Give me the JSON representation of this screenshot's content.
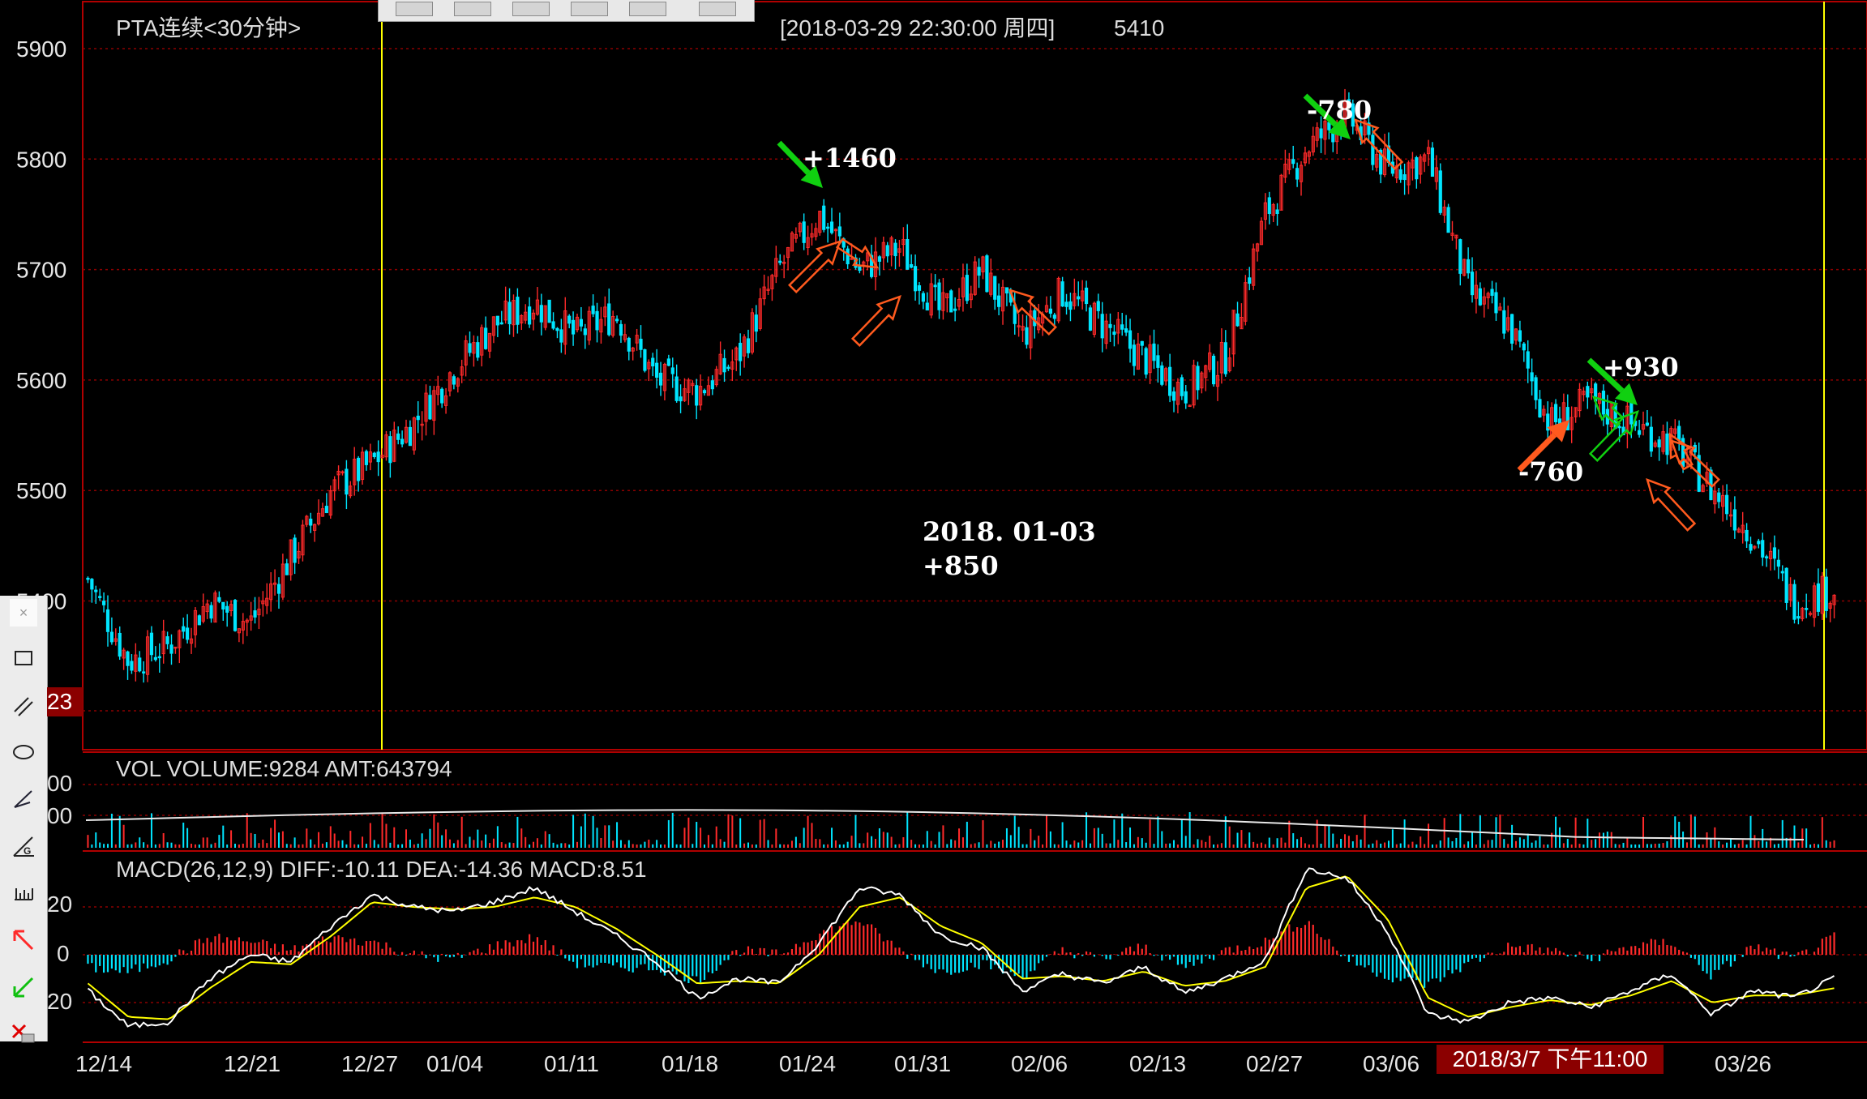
{
  "header": {
    "symbol_title": "PTA连续<30分钟>",
    "datetime_info": "[2018-03-29  22:30:00 周四]",
    "last_price": "5410"
  },
  "volume_panel": {
    "label": "VOL  VOLUME:9284 AMT:643794",
    "y_tick_labels": [
      "00",
      "00"
    ]
  },
  "macd_panel": {
    "label": "MACD(26,12,9)  DIFF:-10.11 DEA:-14.36 MACD:8.51",
    "y_tick_labels": [
      "20",
      "0",
      "20"
    ]
  },
  "cursor": {
    "date_label": "2018/3/7 下午11:00",
    "price_tag": "23"
  },
  "annotations": [
    {
      "text": "+1460",
      "color": "#ffffff"
    },
    {
      "text": "-780",
      "color": "#ffffff"
    },
    {
      "text": "+930",
      "color": "#ffffff"
    },
    {
      "text": "-760",
      "color": "#ffffff"
    },
    {
      "text": "2018. 01-03",
      "color": "#ffffff"
    },
    {
      "text": "+850",
      "color": "#ffffff"
    }
  ],
  "toolbox": {
    "tools": [
      "close-icon",
      "rectangle-tool-icon",
      "parallel-lines-tool-icon",
      "ellipse-tool-icon",
      "pen-tool-icon",
      "golden-ratio-tool-icon",
      "ruler-tool-icon",
      "up-arrow-tool-icon",
      "down-arrow-tool-icon",
      "delete-tool-icon"
    ]
  },
  "colors": {
    "up": "#ff2a2a",
    "down": "#00e5ff",
    "grid": "#8b0000",
    "frame": "#b00000",
    "diff_line": "#ffffff",
    "dea_line": "#ffff00",
    "vertical_marker": "#ffff00",
    "green_arrow": "#10d010",
    "orange_arrow": "#ff5a1e"
  },
  "chart_data": [
    {
      "type": "line",
      "name": "price",
      "title": "PTA连续<30分钟>",
      "ylim": [
        5310,
        5920
      ],
      "y_ticks": [
        5400,
        5500,
        5600,
        5700,
        5800,
        5900
      ],
      "x_tick_labels": [
        "12/14",
        "12/21",
        "12/27",
        "01/04",
        "01/11",
        "01/18",
        "01/24",
        "01/31",
        "02/06",
        "02/13",
        "02/27",
        "03/06",
        "03/26"
      ],
      "x": [
        "12/14",
        "12/16",
        "12/18",
        "12/21",
        "12/23",
        "12/25",
        "12/27",
        "12/29",
        "01/02",
        "01/04",
        "01/06",
        "01/09",
        "01/11",
        "01/13",
        "01/16",
        "01/18",
        "01/20",
        "01/22",
        "01/24",
        "01/26",
        "01/29",
        "01/31",
        "02/02",
        "02/04",
        "02/06",
        "02/08",
        "02/11",
        "02/13",
        "02/15",
        "02/22",
        "02/27",
        "03/01",
        "03/03",
        "03/06",
        "03/08",
        "03/10",
        "03/13",
        "03/15",
        "03/17",
        "03/20",
        "03/22",
        "03/26",
        "03/28",
        "03/29"
      ],
      "values": [
        5420,
        5345,
        5360,
        5400,
        5380,
        5440,
        5500,
        5525,
        5560,
        5610,
        5650,
        5670,
        5640,
        5660,
        5600,
        5590,
        5620,
        5700,
        5750,
        5700,
        5720,
        5660,
        5700,
        5640,
        5680,
        5650,
        5620,
        5590,
        5620,
        5750,
        5810,
        5840,
        5790,
        5800,
        5680,
        5650,
        5560,
        5580,
        5560,
        5545,
        5500,
        5460,
        5400,
        5410
      ]
    },
    {
      "type": "bar",
      "name": "volume",
      "title": "VOL",
      "values": [
        9284
      ]
    },
    {
      "type": "line",
      "name": "macd",
      "title": "MACD(26,12,9)",
      "ylim": [
        -32,
        38
      ],
      "y_ticks": [
        -20,
        0,
        20
      ],
      "series": [
        {
          "name": "DIFF",
          "values": [
            -15,
            -30,
            -28,
            -10,
            0,
            -3,
            12,
            25,
            20,
            18,
            22,
            28,
            18,
            8,
            -3,
            -18,
            -10,
            -12,
            5,
            28,
            25,
            8,
            3,
            -15,
            -8,
            -12,
            -5,
            -16,
            -10,
            -2,
            36,
            32,
            10,
            -25,
            -28,
            -20,
            -18,
            -22,
            -15,
            -8,
            -25,
            -15,
            -18,
            -10
          ]
        },
        {
          "name": "DEA",
          "values": [
            -12,
            -26,
            -27,
            -14,
            -3,
            -4,
            8,
            22,
            20,
            19,
            20,
            24,
            20,
            11,
            0,
            -12,
            -11,
            -12,
            0,
            20,
            24,
            12,
            5,
            -10,
            -9,
            -11,
            -7,
            -13,
            -11,
            -5,
            28,
            33,
            15,
            -18,
            -26,
            -22,
            -19,
            -21,
            -17,
            -11,
            -20,
            -17,
            -17,
            -14
          ]
        }
      ]
    }
  ]
}
